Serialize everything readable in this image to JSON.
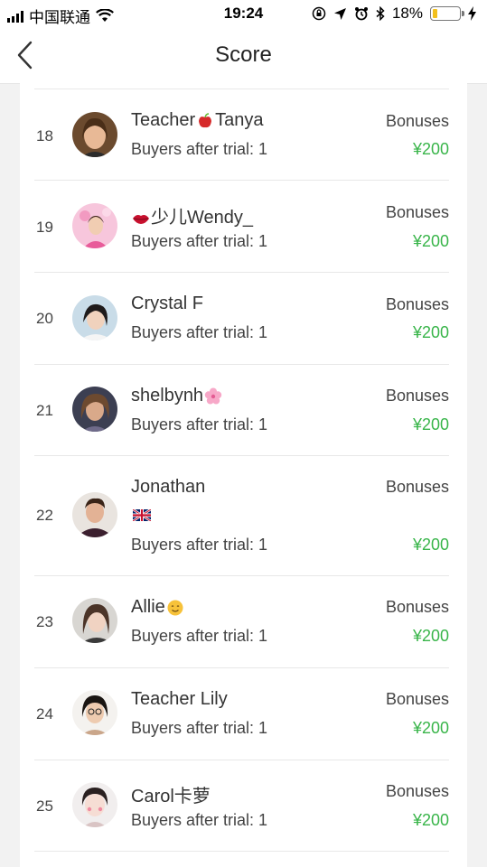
{
  "status_bar": {
    "carrier": "中国联通",
    "time": "19:24",
    "battery": "18%",
    "battery_level": 0.18
  },
  "header": {
    "title": "Score",
    "back_icon": "chevron-left-icon"
  },
  "rows": [
    {
      "rank": "18",
      "name_prefix": "Teacher",
      "name_suffix": "Tanya",
      "emoji": "apple",
      "sub": "Buyers after trial: 1",
      "bonus_label": "Bonuses",
      "bonus_amount": "¥200"
    },
    {
      "rank": "19",
      "name_prefix": "",
      "name_suffix": "少儿Wendy_",
      "emoji": "lips",
      "sub": "Buyers after trial: 1",
      "bonus_label": "Bonuses",
      "bonus_amount": "¥200"
    },
    {
      "rank": "20",
      "name_prefix": "Crystal F",
      "name_suffix": "",
      "emoji": "",
      "sub": "Buyers after trial: 1",
      "bonus_label": "Bonuses",
      "bonus_amount": "¥200"
    },
    {
      "rank": "21",
      "name_prefix": "shelbynh",
      "name_suffix": "",
      "emoji": "blossom",
      "sub": "Buyers after trial: 1",
      "bonus_label": "Bonuses",
      "bonus_amount": "¥200"
    },
    {
      "rank": "22",
      "name_prefix": "Jonathan",
      "name_suffix": "",
      "emoji": "",
      "flag": "uk-flag",
      "sub": "Buyers after trial: 1",
      "bonus_label": "Bonuses",
      "bonus_amount": "¥200"
    },
    {
      "rank": "23",
      "name_prefix": "Allie",
      "name_suffix": "",
      "emoji": "smile",
      "sub": "Buyers after trial: 1",
      "bonus_label": "Bonuses",
      "bonus_amount": "¥200"
    },
    {
      "rank": "24",
      "name_prefix": "Teacher Lily",
      "name_suffix": "",
      "emoji": "",
      "sub": "Buyers after trial: 1",
      "bonus_label": "Bonuses",
      "bonus_amount": "¥200"
    },
    {
      "rank": "25",
      "name_prefix": "Carol卡萝",
      "name_suffix": "",
      "emoji": "",
      "sub": "Buyers after trial: 1",
      "bonus_label": "Bonuses",
      "bonus_amount": "¥200"
    }
  ],
  "colors": {
    "bonus_amount": "#39b54a",
    "background": "#f2f2f2",
    "battery": "#f2c01e"
  }
}
